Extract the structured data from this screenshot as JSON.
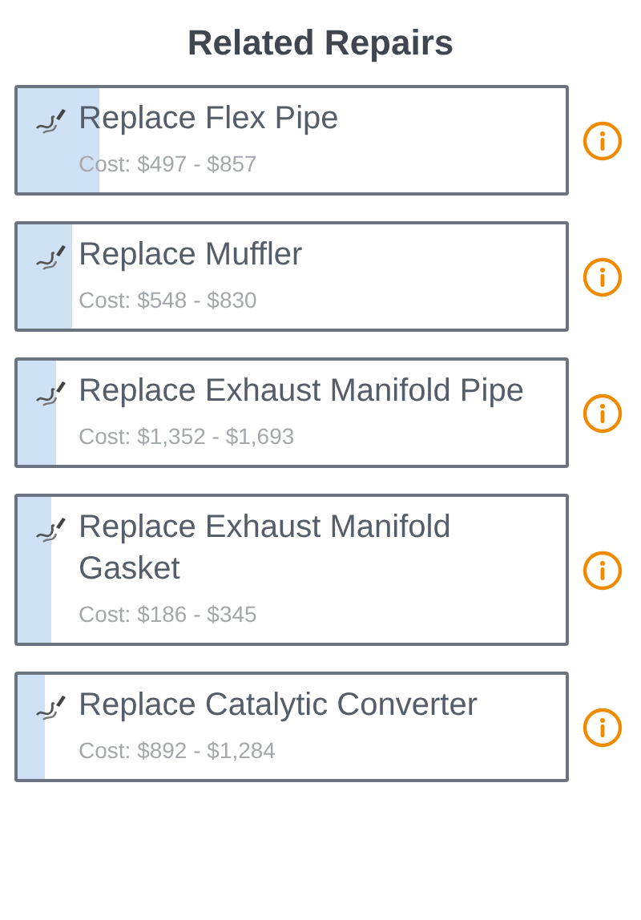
{
  "title": "Related Repairs",
  "repairs": [
    {
      "name": "Replace Flex Pipe",
      "cost": "Cost: $497 - $857",
      "level": 0.15
    },
    {
      "name": "Replace Muffler",
      "cost": "Cost: $548 - $830",
      "level": 0.1
    },
    {
      "name": "Replace Exhaust Manifold Pipe",
      "cost": "Cost: $1,352 - $1,693",
      "level": 0.07
    },
    {
      "name": "Replace Exhaust Manifold Gasket",
      "cost": "Cost: $186 - $345",
      "level": 0.06
    },
    {
      "name": "Replace Catalytic Converter",
      "cost": "Cost: $892 - $1,284",
      "level": 0.05
    }
  ]
}
